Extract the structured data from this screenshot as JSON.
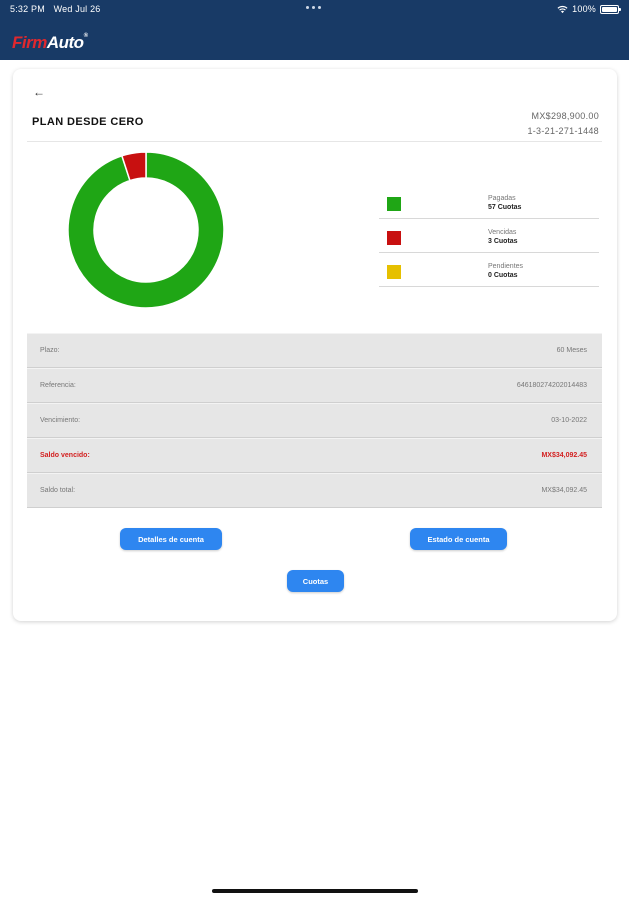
{
  "status_bar": {
    "time": "5:32 PM",
    "date": "Wed Jul 26",
    "battery": "100%"
  },
  "brand": {
    "logo_part1": "Firm",
    "logo_part2": "Auto",
    "logo_mark": "®"
  },
  "header": {
    "back_icon": "←",
    "title": "PLAN DESDE CERO",
    "amount": "MX$298,900.00",
    "account_number": "1-3-21-271-1448"
  },
  "chart_data": {
    "type": "pie",
    "categories": [
      "Pagadas",
      "Vencidas",
      "Pendientes"
    ],
    "values": [
      57,
      3,
      0
    ],
    "colors": [
      "#1fa615",
      "#c81010",
      "#e6c000"
    ],
    "donut": true,
    "legend_position": "right"
  },
  "legend": [
    {
      "label": "Pagadas",
      "count": "57 Cuotas",
      "color": "#1fa615"
    },
    {
      "label": "Vencidas",
      "count": "3 Cuotas",
      "color": "#c81010"
    },
    {
      "label": "Pendientes",
      "count": "0 Cuotas",
      "color": "#e6c000"
    }
  ],
  "details": [
    {
      "label": "Plazo:",
      "value": "60 Meses"
    },
    {
      "label": "Referencia:",
      "value": "646180274202014483"
    },
    {
      "label": "Vencimiento:",
      "value": "03-10-2022"
    },
    {
      "label": "Saldo vencido:",
      "value": "MX$34,092.45",
      "alert": true
    },
    {
      "label": "Saldo total:",
      "value": "MX$34,092.45"
    }
  ],
  "buttons": {
    "details": "Detalles de cuenta",
    "statement": "Estado de cuenta",
    "installments": "Cuotas"
  },
  "colors": {
    "header_bg": "#183a66",
    "button": "#2e86f0",
    "alert": "#d32020"
  }
}
